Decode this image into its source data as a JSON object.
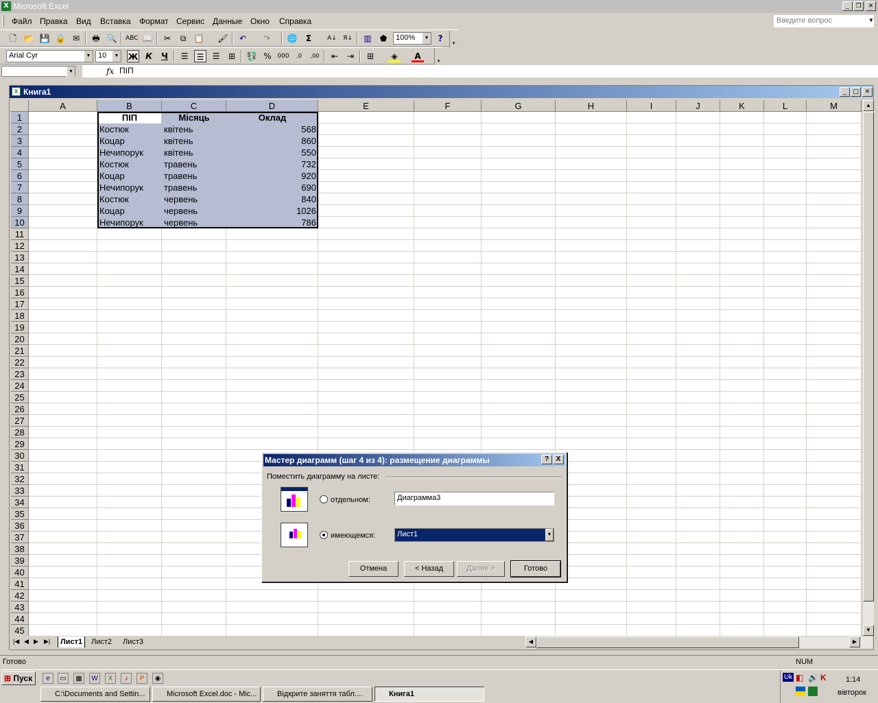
{
  "app": {
    "title": "Microsoft Excel"
  },
  "menu": [
    "Файл",
    "Правка",
    "Вид",
    "Вставка",
    "Формат",
    "Сервис",
    "Данные",
    "Окно",
    "Справка"
  ],
  "ask_placeholder": "Введите вопрос",
  "toolbar": {
    "zoom": "100%"
  },
  "format_toolbar": {
    "font": "Arial Cyr",
    "size": "10",
    "bold": "Ж",
    "italic": "К",
    "underline": "Ч"
  },
  "formula_bar": {
    "name_box": "",
    "fx": "fx",
    "value": "ПІП"
  },
  "workbook": {
    "title": "Книга1"
  },
  "columns": [
    "A",
    "B",
    "C",
    "D",
    "E",
    "F",
    "G",
    "H",
    "I",
    "J",
    "K",
    "L",
    "M"
  ],
  "rows": [
    "1",
    "2",
    "3",
    "4",
    "5",
    "6",
    "7",
    "8",
    "9",
    "10",
    "11",
    "12",
    "13",
    "14",
    "15",
    "16",
    "17",
    "18",
    "19",
    "20",
    "21",
    "22",
    "23",
    "24",
    "25",
    "26",
    "27",
    "28",
    "29",
    "30",
    "31",
    "32",
    "33",
    "34",
    "35",
    "36",
    "37",
    "38",
    "39",
    "40",
    "41",
    "42",
    "43",
    "44",
    "45"
  ],
  "table": {
    "headers": [
      "ПІП",
      "Місяць",
      "Оклад"
    ],
    "rows": [
      [
        "Костюк",
        "квітень",
        "568"
      ],
      [
        "Коцар",
        "квітень",
        "860"
      ],
      [
        "Нечипорук",
        "квітень",
        "550"
      ],
      [
        "Костюк",
        "травень",
        "732"
      ],
      [
        "Коцар",
        "травень",
        "920"
      ],
      [
        "Нечипорук",
        "травень",
        "690"
      ],
      [
        "Костюк",
        "червень",
        "840"
      ],
      [
        "Коцар",
        "червень",
        "1026"
      ],
      [
        "Нечипорук",
        "червень",
        "786"
      ]
    ]
  },
  "sheets": [
    "Лист1",
    "Лист2",
    "Лист3"
  ],
  "dialog": {
    "title": "Мастер диаграмм (шаг 4 из 4): размещение диаграммы",
    "group_label": "Поместить диаграмму на листе:",
    "opt_separate": "отдельном:",
    "opt_separate_value": "Диаграмма3",
    "opt_existing": "имеющемся:",
    "opt_existing_value": "Лист1",
    "btn_cancel": "Отмена",
    "btn_back": "< Назад",
    "btn_next": "Далее >",
    "btn_finish": "Готово",
    "help": "?",
    "close": "X"
  },
  "status": {
    "text": "Готово",
    "num": "NUM"
  },
  "taskbar": {
    "start": "Пуск",
    "tasks": [
      "C:\\Documents and Settin...",
      "Microsoft Excel.doc - Mic...",
      "Відкрите заняття табл....",
      "Книга1"
    ],
    "lang": "Uk",
    "time": "1:14",
    "day": "вівторок"
  }
}
